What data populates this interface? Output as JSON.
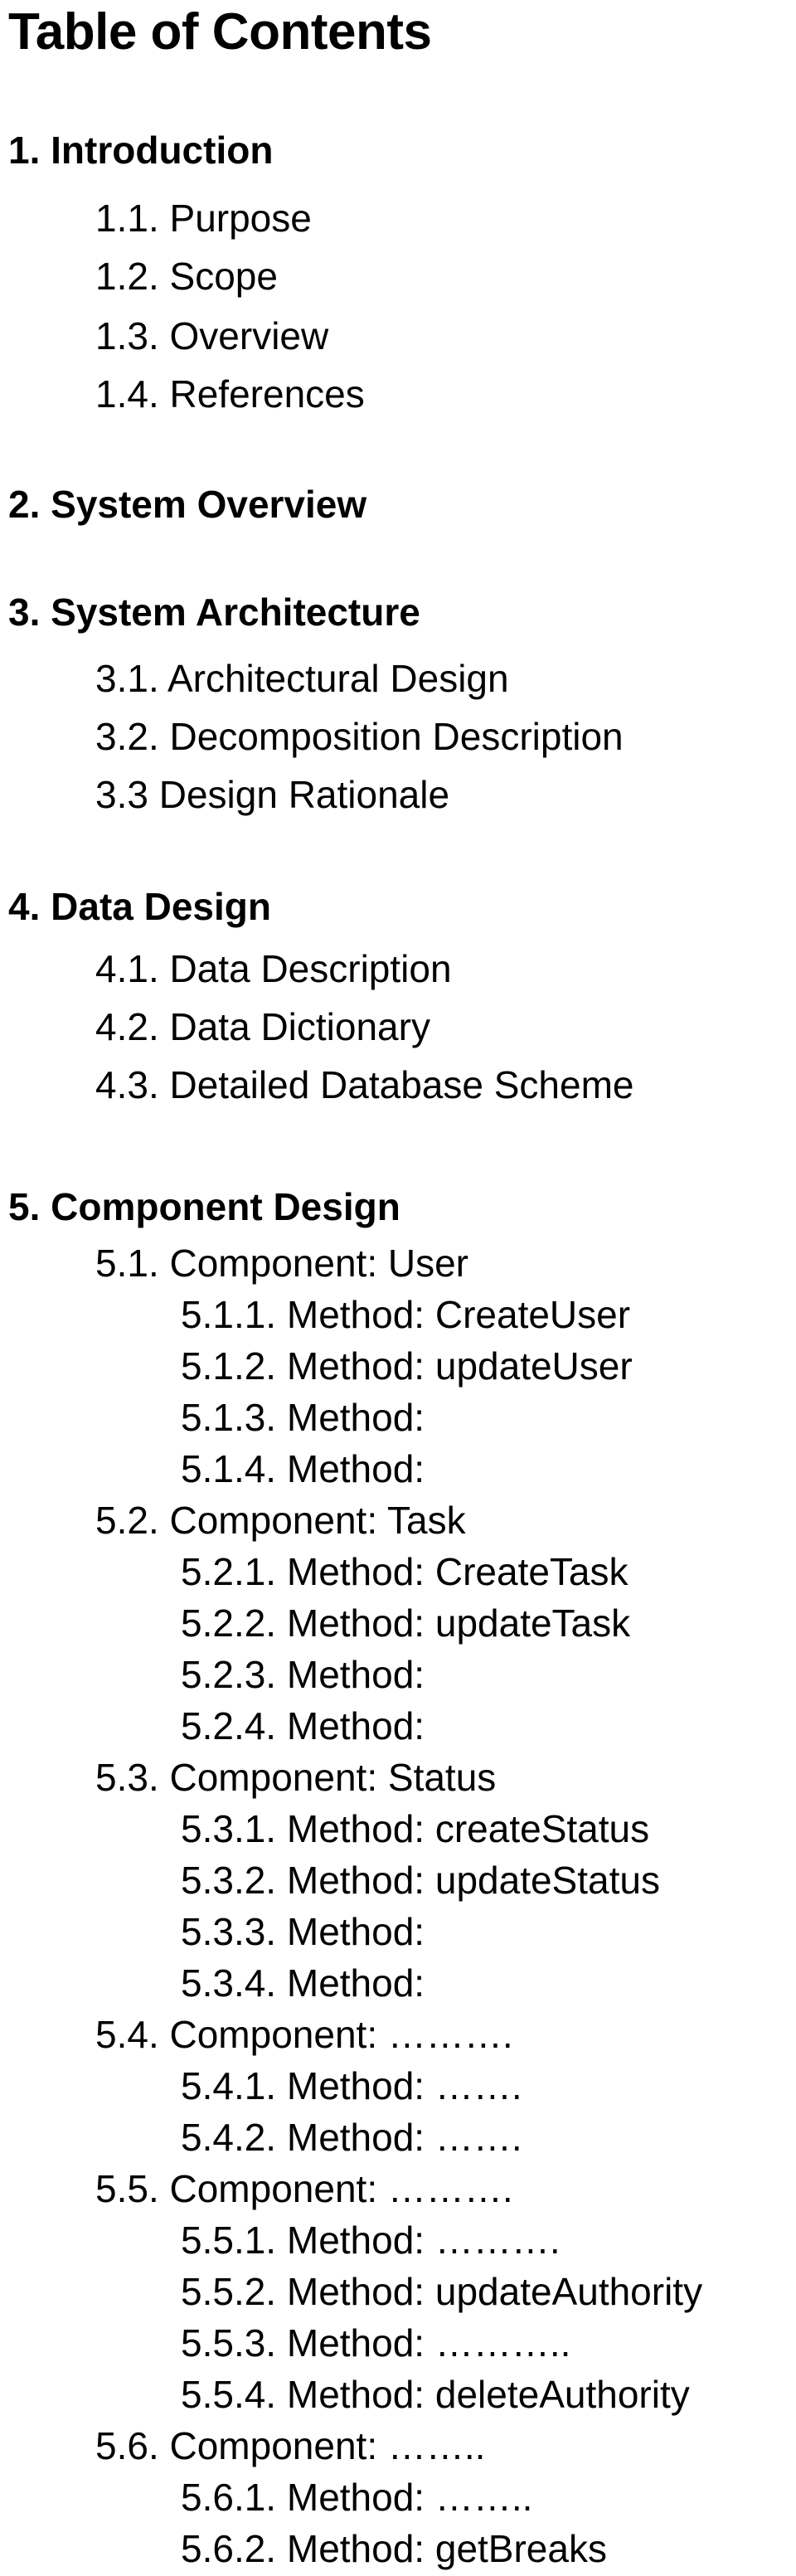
{
  "document": {
    "title": "Table of Contents",
    "entries": [
      {
        "level": 1,
        "text": "1. Introduction"
      },
      {
        "level": 2,
        "text": "1.1. Purpose"
      },
      {
        "level": 2,
        "text": "1.2. Scope"
      },
      {
        "level": 2,
        "text": "1.3. Overview"
      },
      {
        "level": 2,
        "text": "1.4. References"
      },
      {
        "level": 1,
        "text": "2. System Overview"
      },
      {
        "level": 1,
        "text": "3. System Architecture"
      },
      {
        "level": 2,
        "text": "3.1. Architectural Design"
      },
      {
        "level": 2,
        "text": "3.2. Decomposition Description"
      },
      {
        "level": 2,
        "text": "3.3 Design Rationale"
      },
      {
        "level": 1,
        "text": "4. Data Design"
      },
      {
        "level": 2,
        "text": "4.1. Data Description"
      },
      {
        "level": 2,
        "text": "4.2. Data Dictionary"
      },
      {
        "level": 2,
        "text": "4.3. Detailed Database Scheme"
      },
      {
        "level": 1,
        "text": "5. Component Design"
      },
      {
        "level": 2,
        "text": "5.1. Component: User"
      },
      {
        "level": 3,
        "text": "5.1.1. Method: CreateUser"
      },
      {
        "level": 3,
        "text": "5.1.2. Method: updateUser"
      },
      {
        "level": 3,
        "text": "5.1.3. Method:"
      },
      {
        "level": 3,
        "text": "5.1.4. Method:"
      },
      {
        "level": 2,
        "text": "5.2. Component: Task"
      },
      {
        "level": 3,
        "text": "5.2.1. Method: CreateTask"
      },
      {
        "level": 3,
        "text": "5.2.2. Method: updateTask"
      },
      {
        "level": 3,
        "text": "5.2.3. Method:"
      },
      {
        "level": 3,
        "text": "5.2.4. Method:"
      },
      {
        "level": 2,
        "text": "5.3. Component: Status"
      },
      {
        "level": 3,
        "text": "5.3.1. Method: createStatus"
      },
      {
        "level": 3,
        "text": "5.3.2. Method: updateStatus"
      },
      {
        "level": 3,
        "text": "5.3.3. Method:"
      },
      {
        "level": 3,
        "text": "5.3.4. Method:"
      },
      {
        "level": 2,
        "text": "5.4. Component: ………."
      },
      {
        "level": 3,
        "text": "5.4.1. Method: ……."
      },
      {
        "level": 3,
        "text": "5.4.2. Method: ……."
      },
      {
        "level": 2,
        "text": "5.5. Component: ………."
      },
      {
        "level": 3,
        "text": "5.5.1. Method: ………."
      },
      {
        "level": 3,
        "text": "5.5.2. Method: updateAuthority"
      },
      {
        "level": 3,
        "text": "5.5.3. Method: ……….."
      },
      {
        "level": 3,
        "text": "5.5.4. Method: deleteAuthority"
      },
      {
        "level": 2,
        "text": "5.6. Component: …….."
      },
      {
        "level": 3,
        "text": "5.6.1. Method: …….."
      },
      {
        "level": 3,
        "text": "5.6.2. Method: getBreaks"
      }
    ]
  }
}
